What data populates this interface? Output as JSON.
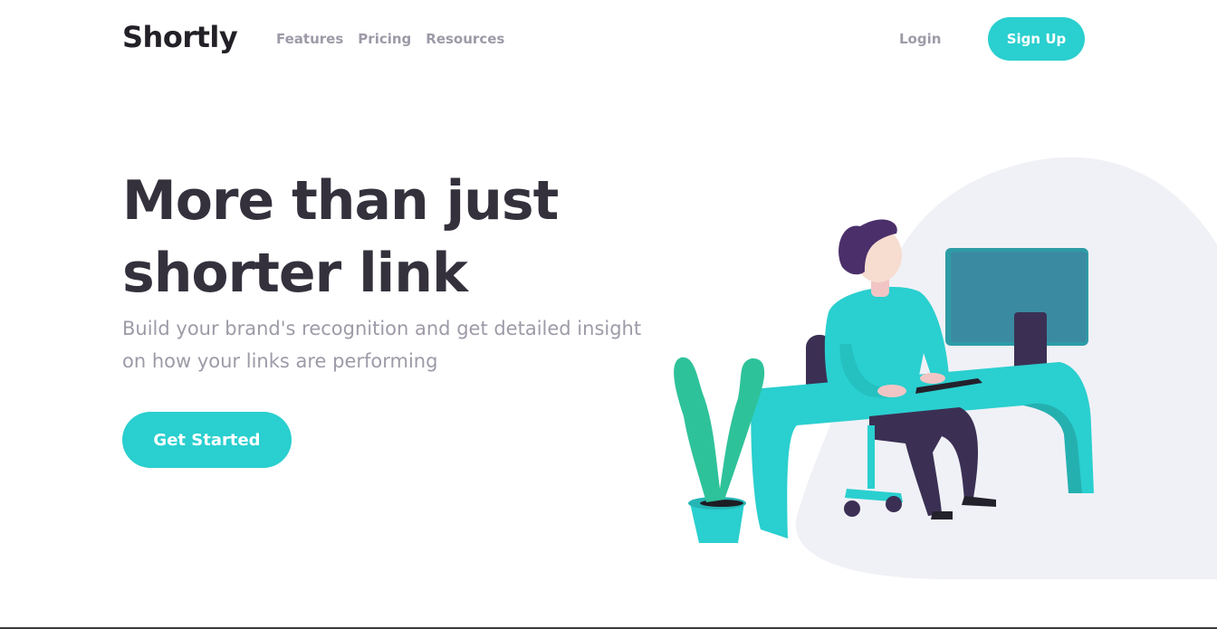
{
  "header": {
    "logo": "Shortly",
    "nav": [
      "Features",
      "Pricing",
      "Resources"
    ],
    "login": "Login",
    "signup": "Sign Up"
  },
  "hero": {
    "title_line1": "More than just",
    "title_line2": "shorter link",
    "subtitle": "Build your brand's recognition and get detailed insight on how your links are performing",
    "cta": "Get Started"
  },
  "colors": {
    "accent": "#2acfcf",
    "dark_text": "#34313d",
    "muted_text": "#9e9aa7",
    "blob": "#f0f1f6"
  },
  "icons": [
    "person-working-illustration"
  ]
}
